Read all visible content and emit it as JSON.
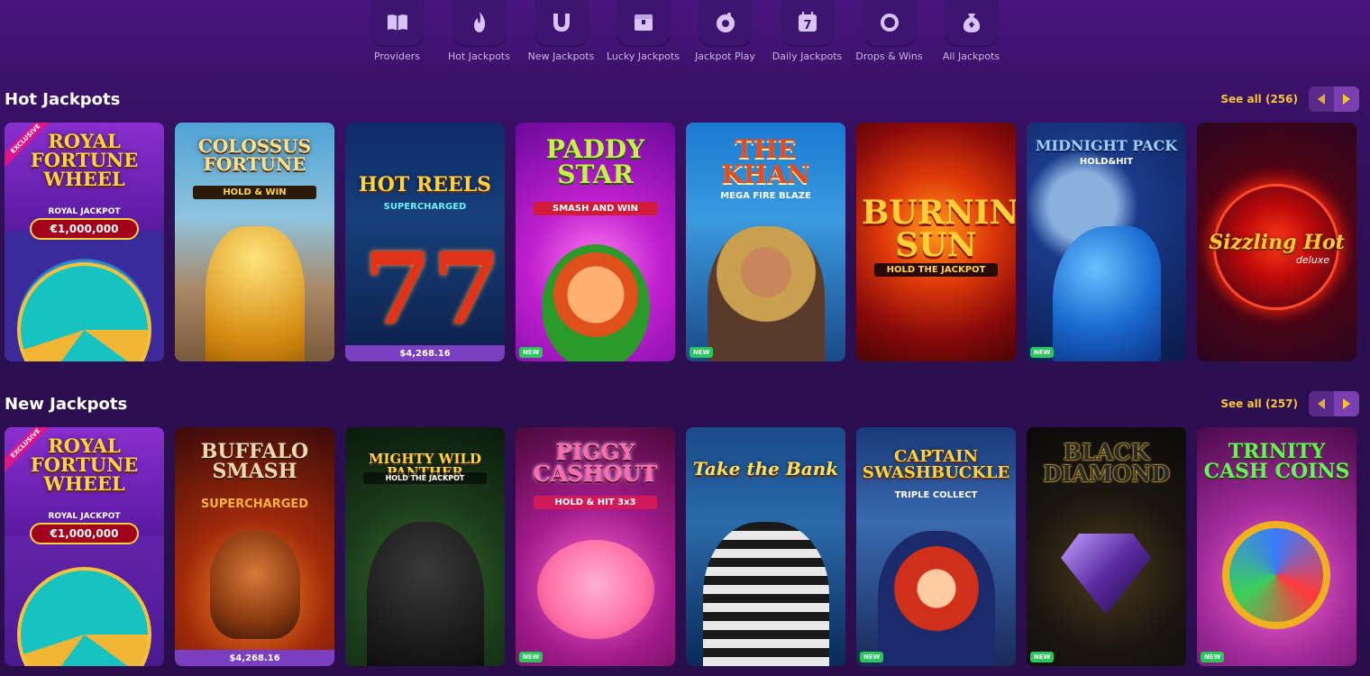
{
  "nav": {
    "items": [
      {
        "label": "Providers",
        "icon": "book-icon"
      },
      {
        "label": "Hot Jackpots",
        "icon": "flame-icon"
      },
      {
        "label": "New Jackpots",
        "icon": "horseshoe-icon"
      },
      {
        "label": "Lucky Jackpots",
        "icon": "treasure-chest-icon"
      },
      {
        "label": "Jackpot Play",
        "icon": "ball-icon"
      },
      {
        "label": "Daily Jackpots",
        "icon": "calendar-7-icon"
      },
      {
        "label": "Drops & Wins",
        "icon": "drops-wins-icon"
      },
      {
        "label": "All Jackpots",
        "icon": "money-bag-icon"
      }
    ]
  },
  "sections": {
    "hot": {
      "title": "Hot Jackpots",
      "see_all": "See all (256)",
      "tiles": [
        {
          "name": "Royal Fortune Wheel",
          "badge_excl": "EXCLUSIVE",
          "prize_label": "ROYAL JACKPOT",
          "prize": "€1,000,000"
        },
        {
          "name": "Colossus Fortune",
          "sub": "HOLD & WIN"
        },
        {
          "name": "Hot Reels",
          "sub": "SUPERCHARGED",
          "jackpot": "$4,268.16"
        },
        {
          "name": "Paddy Star",
          "sub": "SMASH AND WIN",
          "badge_new": "NEW"
        },
        {
          "name": "The Khan",
          "sub": "MEGA FIRE BLAZE",
          "badge_new": "NEW"
        },
        {
          "name": "Burning Sun",
          "sub": "HOLD THE JACKPOT"
        },
        {
          "name": "Midnight Pack",
          "sub": "HOLD&HIT",
          "badge_new": "NEW"
        },
        {
          "name": "Sizzling Hot",
          "sub": "deluxe"
        }
      ]
    },
    "new": {
      "title": "New Jackpots",
      "see_all": "See all (257)",
      "tiles": [
        {
          "name": "Royal Fortune Wheel",
          "badge_excl": "EXCLUSIVE",
          "prize_label": "ROYAL JACKPOT",
          "prize": "€1,000,000"
        },
        {
          "name": "Buffalo Smash",
          "sub": "SUPERCHARGED",
          "jackpot": "$4,268.16"
        },
        {
          "name": "Mighty Wild Panther",
          "sub": "HOLD THE JACKPOT"
        },
        {
          "name": "Piggy Cashout",
          "sub": "HOLD & HIT 3x3",
          "badge_new": "NEW"
        },
        {
          "name": "Take the Bank",
          "sub": ""
        },
        {
          "name": "Captain Swashbuckle",
          "sub": "TRIPLE COLLECT",
          "badge_new": "NEW"
        },
        {
          "name": "Black Diamond",
          "sub": "",
          "badge_new": "NEW"
        },
        {
          "name": "Trinity Cash Coins",
          "sub": "",
          "badge_new": "NEW"
        }
      ]
    }
  }
}
